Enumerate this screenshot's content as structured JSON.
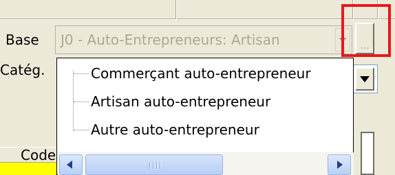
{
  "form": {
    "base_label": "Base",
    "base_value": "J0 - Auto-Entrepreneurs: Artisan",
    "browse_label": "...",
    "categ_label": "Catég.",
    "code_header": "Code"
  },
  "dropdown": {
    "items": [
      {
        "label": "Commerçant auto-entrepreneur"
      },
      {
        "label": "Artisan auto-entrepreneur"
      },
      {
        "label": "Autre auto-entrepreneur"
      }
    ]
  },
  "colors": {
    "highlight": "#e8171c",
    "window_bg": "#ece9d8",
    "yellow_cell": "#ffff00"
  },
  "icons": [
    "chevron-down-icon",
    "scroll-left-icon",
    "scroll-right-icon",
    "scroll-grip-icon",
    "tree-line-icon"
  ]
}
